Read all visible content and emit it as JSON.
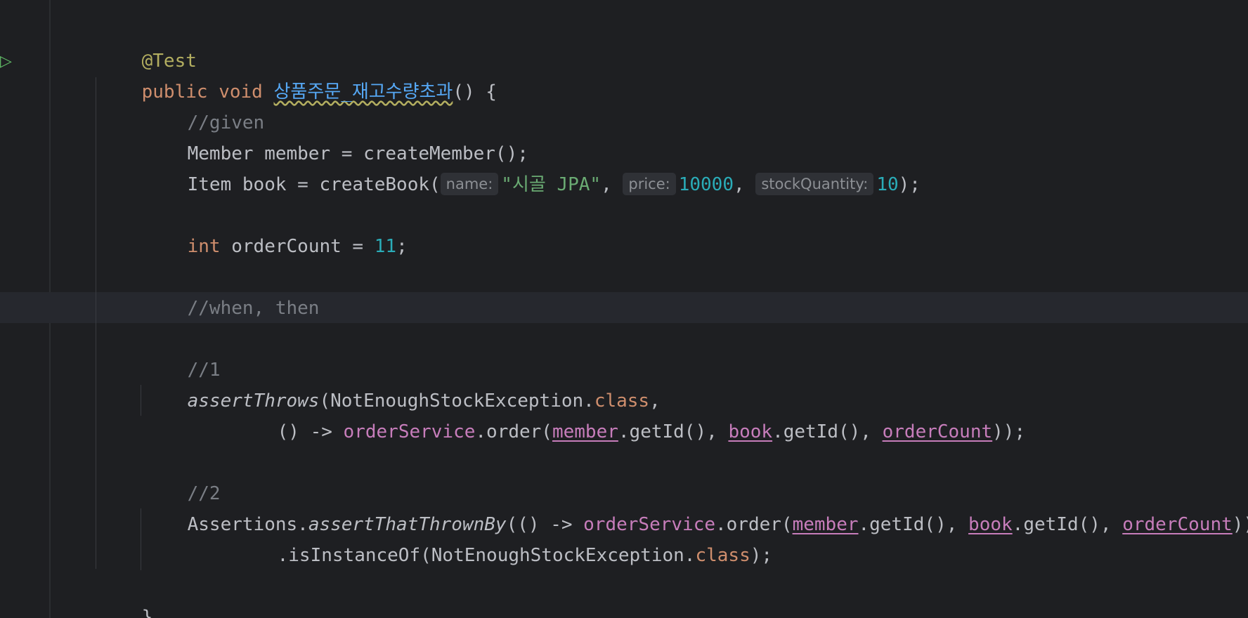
{
  "editor": {
    "lines": {
      "l1": {
        "annotation": "@Test"
      },
      "l2": {
        "kw1": "public",
        "kw2": "void",
        "name": "상품주문_재고수량초과",
        "rest": "() {"
      },
      "l3": {
        "comment": "//given"
      },
      "l4": {
        "text": "Member member = createMember();"
      },
      "l5": {
        "pre": "Item book = createBook(",
        "hint1": "name:",
        "str": "\"시골 JPA\"",
        "sep1": ", ",
        "hint2": "price:",
        "num1": "10000",
        "sep2": ", ",
        "hint3": "stockQuantity:",
        "num2": "10",
        "post": ");"
      },
      "l6": {
        "kw": "int",
        "mid": " orderCount = ",
        "num": "11",
        "end": ";"
      },
      "l7": {
        "comment": "//when, then"
      },
      "l8": {
        "comment": "//1"
      },
      "l9": {
        "method": "assertThrows",
        "open": "(NotEnoughStockException.",
        "kw": "class",
        "end": ","
      },
      "l10": {
        "pre": "() -> ",
        "field": "orderService",
        "call": ".order(",
        "var1": "member",
        "get1": ".getId(), ",
        "var2": "book",
        "get2": ".getId(), ",
        "var3": "orderCount",
        "end": "));"
      },
      "l11": {
        "comment": "//2"
      },
      "l12": {
        "pre": "Assertions.",
        "method": "assertThatThrownBy",
        "mid": "(() -> ",
        "field": "orderService",
        "call": ".order(",
        "var1": "member",
        "get1": ".getId(), ",
        "var2": "book",
        "get2": ".getId(), ",
        "var3": "orderCount",
        "end": "))"
      },
      "l13": {
        "pre": ".isInstanceOf(NotEnoughStockException.",
        "kw": "class",
        "end": ");"
      },
      "l14": {
        "text": "}"
      }
    }
  }
}
